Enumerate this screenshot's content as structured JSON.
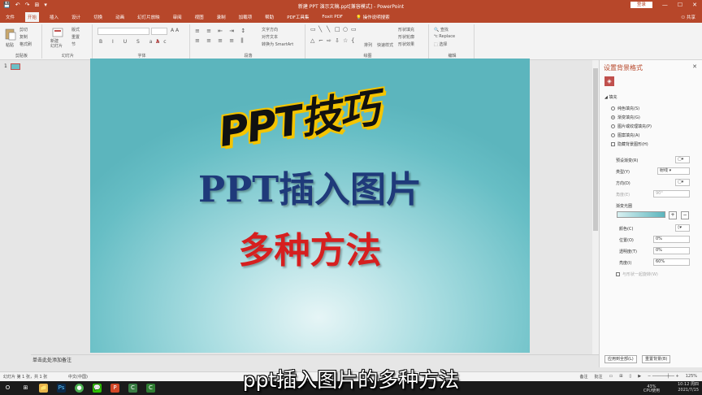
{
  "window": {
    "title": "新建 PPT 演示文稿.ppt[兼容模式] - PowerPoint",
    "login_label": "登录",
    "share_label": "共享",
    "qat": [
      "💾",
      "↶",
      "↷",
      "⊞",
      "▾"
    ],
    "controls": [
      "—",
      "☐",
      "✕"
    ]
  },
  "ribbon": {
    "tabs": [
      "文件",
      "开始",
      "插入",
      "设计",
      "切换",
      "动画",
      "幻灯片放映",
      "审阅",
      "视图",
      "录制",
      "加载项",
      "帮助",
      "PDF工具集",
      "Foxit PDF",
      "操作说明搜索"
    ],
    "active_tab": "开始",
    "groups": {
      "clipboard": {
        "label": "剪贴板",
        "paste": "粘贴",
        "cut": "剪切",
        "copy": "复制",
        "format_painter": "格式刷"
      },
      "slides": {
        "label": "幻灯片",
        "new_slide": "新建\n幻灯片",
        "layout": "版式",
        "reset": "重置",
        "section": "节"
      },
      "font": {
        "label": "字体"
      },
      "paragraph": {
        "label": "段落",
        "text_direction": "文字方向",
        "align_text": "对齐文本",
        "smartart": "转换为 SmartArt"
      },
      "drawing": {
        "label": "绘图",
        "arrange": "排列",
        "quick_styles": "快速样式",
        "fill": "形状填充",
        "outline": "形状轮廓",
        "effects": "形状效果"
      },
      "editing": {
        "label": "编辑",
        "find": "查找",
        "replace": "Replace",
        "select": "选择"
      }
    }
  },
  "thumbnails": {
    "number": "1"
  },
  "slide": {
    "logo_text": "PPT技巧",
    "title_line1": "PPT插入图片",
    "title_line2": "多种方法"
  },
  "notes_placeholder": "单击此处添加备注",
  "format_panel": {
    "title": "设置背景格式",
    "section": "填充",
    "options": [
      "纯色填充(S)",
      "渐变填充(G)",
      "图片或纹理填充(P)",
      "图案填充(A)"
    ],
    "selected_option": "渐变填充(G)",
    "hide_bg_graphics": "隐藏背景图形(H)",
    "preset_label": "预设渐变(R)",
    "type_label": "类型(Y)",
    "type_value": "射线",
    "direction_label": "方向(D)",
    "angle_label": "角度(E)",
    "angle_value": "90°",
    "stops_label": "渐变光圈",
    "color_label": "颜色(C)",
    "position_label": "位置(O)",
    "position_value": "0%",
    "transparency_label": "透明度(T)",
    "transparency_value": "0%",
    "brightness_label": "亮度(I)",
    "brightness_value": "60%",
    "rotate_label": "与形状一起旋转(W)",
    "apply_all": "应用到全部(L)",
    "reset_bg": "重置背景(B)"
  },
  "statusbar": {
    "slide_info": "幻灯片 第 1 张，共 1 张",
    "language": "中文(中国)",
    "notes": "备注",
    "comments": "批注",
    "zoom": "125%"
  },
  "taskbar": {
    "apps": [
      "O",
      "⊞",
      "📁",
      "Ps",
      "●",
      "💬",
      "P",
      "C",
      "C"
    ],
    "cpu": "43%",
    "cpu_label": "CPU使用",
    "time": "10:12 周四",
    "date": "2021/7/15"
  },
  "subtitle": "ppt插入图片的多种方法",
  "colors": {
    "accent": "#b7472a",
    "slide_title": "#1f3a7a",
    "slide_subtitle": "#d61f1f",
    "logo_outline": "#f5c400"
  }
}
